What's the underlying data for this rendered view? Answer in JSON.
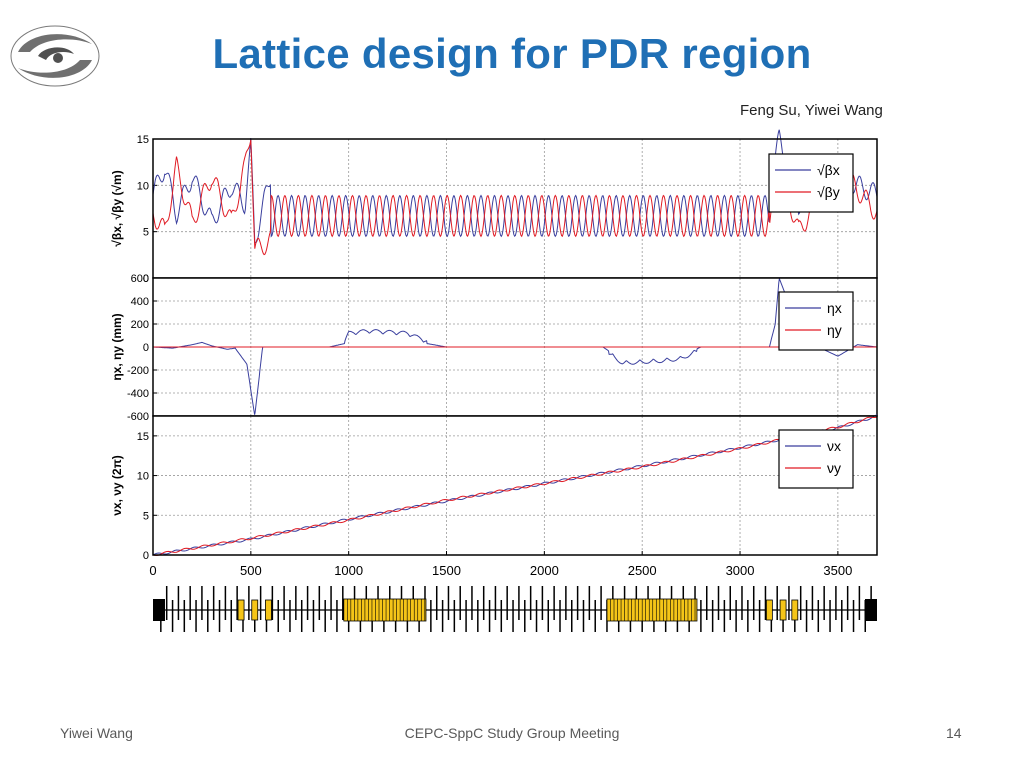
{
  "slide": {
    "title": "Lattice design for PDR region",
    "authors": "Feng Su, Yiwei Wang",
    "footer_left": "Yiwei Wang",
    "footer_center": "CEPC-SppC Study Group Meeting",
    "page_number": "14",
    "logo": "ihep-swirl-logo"
  },
  "colors": {
    "title": "#1f6fb5",
    "series_x": "#3a3f9e",
    "series_y": "#e01b24",
    "magnet": "#f5c518",
    "grid": "#9a9a9a"
  },
  "chart_data": [
    {
      "type": "line",
      "panel": "beta",
      "ylabel": "√βx, √βy (√m)",
      "ylim": [
        0,
        15
      ],
      "yticks": [
        0,
        5,
        10,
        15
      ],
      "grid": true,
      "legend_position": "top-right",
      "series": [
        {
          "name": "√βx",
          "x": [
            0,
            60,
            120,
            200,
            300,
            400,
            470,
            500,
            520,
            600,
            900,
            1400,
            1900,
            2400,
            2900,
            3150,
            3200,
            3300,
            3500,
            3700
          ],
          "y": [
            9,
            12,
            7,
            11,
            6,
            10,
            8,
            14,
            4,
            11,
            4,
            11,
            4,
            11,
            4,
            10,
            15,
            8,
            11,
            9
          ]
        },
        {
          "name": "√βy",
          "x": [
            0,
            60,
            120,
            200,
            300,
            400,
            470,
            500,
            520,
            600,
            900,
            1400,
            1900,
            2400,
            2900,
            3150,
            3200,
            3300,
            3500,
            3700
          ],
          "y": [
            7,
            5,
            12,
            6,
            11,
            6,
            12,
            16,
            3,
            4,
            11,
            4,
            11,
            4,
            11,
            5,
            12,
            5,
            12,
            7
          ]
        }
      ]
    },
    {
      "type": "line",
      "panel": "dispersion",
      "ylabel": "ηx, ηy (mm)",
      "ylim": [
        -600,
        600
      ],
      "yticks": [
        -600,
        -400,
        -200,
        0,
        200,
        400,
        600
      ],
      "grid": true,
      "legend_position": "top-right",
      "series": [
        {
          "name": "ηx",
          "x": [
            0,
            100,
            200,
            250,
            300,
            380,
            420,
            480,
            520,
            560,
            900,
            980,
            1000,
            1100,
            1200,
            1300,
            1400,
            1500,
            2300,
            2350,
            2400,
            2500,
            2600,
            2700,
            2800,
            2900,
            3150,
            3180,
            3200,
            3300,
            3400,
            3500,
            3600,
            3700
          ],
          "y": [
            0,
            -10,
            20,
            40,
            10,
            -20,
            -10,
            -150,
            -600,
            0,
            0,
            30,
            100,
            120,
            110,
            100,
            30,
            0,
            0,
            -60,
            -120,
            -110,
            -100,
            -80,
            0,
            0,
            0,
            200,
            600,
            150,
            0,
            -80,
            20,
            0
          ]
        },
        {
          "name": "ηy",
          "x": [
            0,
            3700
          ],
          "y": [
            0,
            0
          ]
        }
      ]
    },
    {
      "type": "line",
      "panel": "tune",
      "xlabel": "",
      "ylabel": "νx, νy (2π)",
      "xlim": [
        0,
        3700
      ],
      "ylim": [
        0,
        17.5
      ],
      "yticks": [
        0,
        5,
        10,
        15
      ],
      "xticks": [
        0,
        500,
        1000,
        1500,
        2000,
        2500,
        3000,
        3500
      ],
      "grid": true,
      "legend_position": "top-right",
      "series": [
        {
          "name": "νx",
          "x": [
            0,
            500,
            1000,
            1500,
            2000,
            2500,
            3000,
            3500,
            3700
          ],
          "y": [
            0,
            2,
            4.5,
            6.8,
            9,
            11.2,
            13.5,
            16,
            17.5
          ]
        },
        {
          "name": "νy",
          "x": [
            0,
            500,
            1000,
            1500,
            2000,
            2500,
            3000,
            3500,
            3700
          ],
          "y": [
            0,
            2.1,
            4.4,
            6.9,
            9,
            11.1,
            13.4,
            16.1,
            17.5
          ]
        }
      ]
    }
  ],
  "magnet_lattice": {
    "dipole_blocks": [
      [
        975,
        1395
      ],
      [
        2320,
        2780
      ]
    ],
    "small_magnets": [
      450,
      520,
      590,
      3150,
      3220,
      3280
    ],
    "end_blocks": [
      0,
      3700
    ]
  }
}
